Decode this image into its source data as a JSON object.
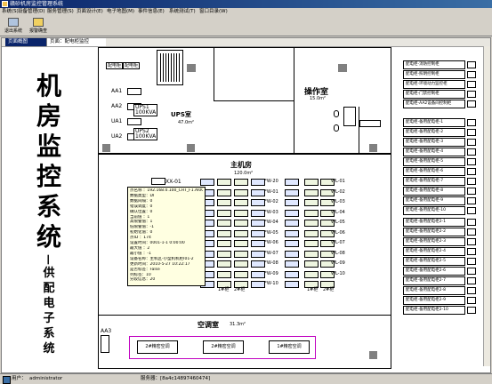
{
  "window": {
    "title": "赣砂机房监控管理系统"
  },
  "menu": [
    "系统(S)",
    "设备管理(D)",
    "服务管理(S)",
    "页面设计(E)",
    "电子地图(M)",
    "事件信息(E)",
    "系统测试(T)",
    "窗口目录(W)"
  ],
  "toolbar": {
    "exit_label": "退出系统",
    "alarm_label": "报警确查"
  },
  "doc_tabs": [
    "页面概图",
    "页面：配电柜监控"
  ],
  "left_title": {
    "big": [
      "机",
      "房",
      "监",
      "控",
      "系",
      "统"
    ],
    "dash": "—",
    "small": [
      "供",
      "配",
      "电",
      "子",
      "系",
      "统"
    ]
  },
  "rooms": {
    "ups": {
      "name": "UPS室",
      "area": "47.0m²"
    },
    "ops": {
      "name": "操作室",
      "area": "15.0m²"
    },
    "main": {
      "name": "主机房",
      "area": "120.0m²"
    },
    "ac": {
      "name": "空调室",
      "area": "31.3m²"
    }
  },
  "cabinets_top": [
    "配电柜",
    "配电柜"
  ],
  "aa_labels": [
    "AA1",
    "AA2",
    "UA1",
    "UA2",
    "AA3"
  ],
  "ups_units": [
    {
      "name": "UPS1",
      "rating": "100KVA"
    },
    {
      "name": "UPS2",
      "rating": "100KVA"
    }
  ],
  "xx_label": "XX-01",
  "fw_labels": [
    "FW-20",
    "FW-01",
    "FW-02",
    "FW-03",
    "FW-04",
    "FW-05",
    "FW-06",
    "FW-07",
    "FW-08",
    "FW-09",
    "FW-10"
  ],
  "wl_labels": [
    "WL-01",
    "WL-02",
    "WL-03",
    "WL-04",
    "WL-05",
    "WL-06",
    "WL-07",
    "WL-08",
    "WL-09",
    "WL-10"
  ],
  "row_labels": [
    "1#柜",
    "2#柜"
  ],
  "tooltip": [
    "点名称 ：192.168.0.100_CHT_F1.AI009_DI",
    "数据类型：DI",
    "数据间隔：0",
    "错误调度：0",
    "确认位置：0",
    "当前值 ：1",
    "高限警值：1",
    "低限警值：-1",
    "初始化值：0",
    "点ID ：174",
    "设置时间：0001-1-1 0:00:00",
    "最大值 ：2",
    "最小值 ：-1",
    "设备名称：主机区-小型机机柜I01-2",
    "更新时间：2010-5-27 10:22:17",
    "是否标签：False",
    "列标签：10",
    "分段信息：20"
  ],
  "ac_units": [
    "2#精密空调",
    "2#精密空调",
    "1#精密空调"
  ],
  "right_panel": {
    "group1": [
      "配电柜-消防控制柜",
      "配电柜-照明控制柜",
      "配电柜-环境动力监控柜",
      "配电柜-门禁控制柜",
      "配电柜-AA2设备间控制柜"
    ],
    "group2": [
      "配电柜-备用配电柜-1",
      "配电柜-备用配电柜-2",
      "配电柜-备用配电柜-3",
      "配电柜-备用配电柜-4",
      "配电柜-备用配电柜-5",
      "配电柜-备用配电柜-6",
      "配电柜-备用配电柜-7",
      "配电柜-备用配电柜-8",
      "配电柜-备用配电柜-9",
      "配电柜-备用配电柜-10"
    ],
    "group3": [
      "配电柜-备用配电柜2-1",
      "配电柜-备用配电柜2-2",
      "配电柜-备用配电柜2-3",
      "配电柜-备用配电柜2-4",
      "配电柜-备用配电柜2-5",
      "配电柜-备用配电柜2-6",
      "配电柜-备用配电柜2-7",
      "配电柜-备用配电柜2-8",
      "配电柜-备用配电柜2-9",
      "配电柜-备用配电柜2-10"
    ]
  },
  "status": {
    "user_label": "用户：",
    "user_value": "administrator",
    "server": "服务器：[8a4c14897460474]"
  }
}
